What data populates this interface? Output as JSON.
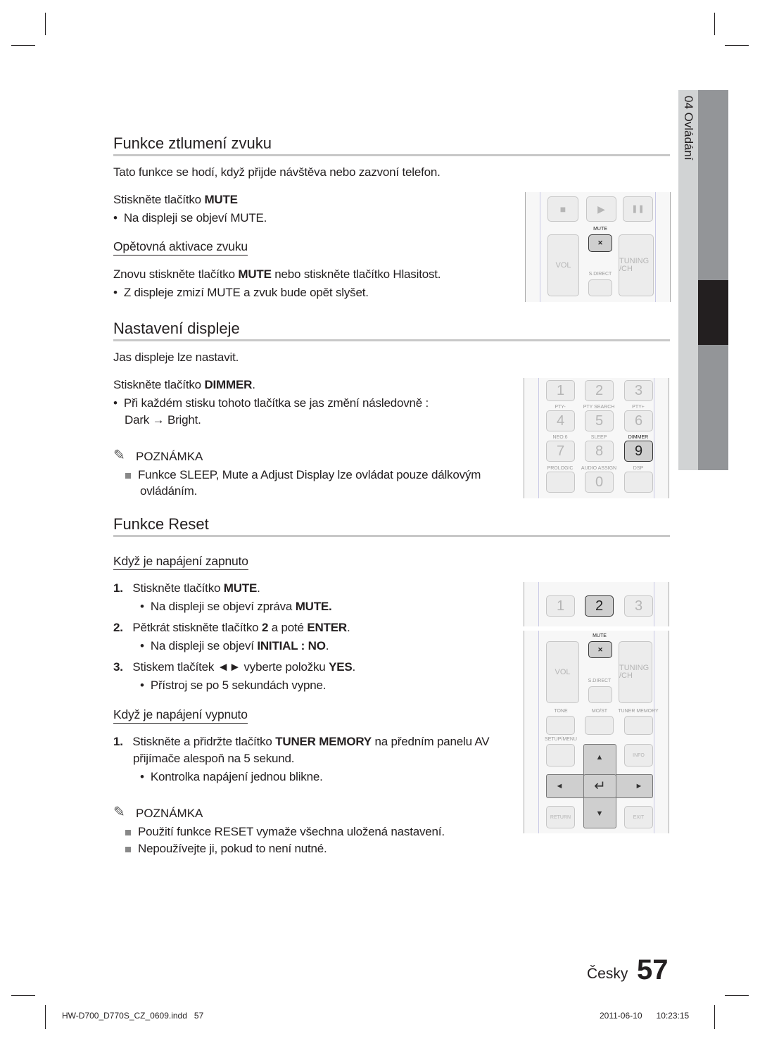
{
  "side_tab": {
    "label": "04  Ovládání"
  },
  "sections": {
    "mute": {
      "title": "Funkce ztlumení zvuku",
      "intro": "Tato funkce se hodí, když přijde návštěva nebo zazvoní telefon.",
      "press_prefix": "Stiskněte tlačítko ",
      "press_key": "MUTE",
      "bullet": "Na displeji se objeví MUTE.",
      "reactivate_title": "Opětovná aktivace zvuku",
      "reactivate_prefix": "Znovu stiskněte tlačítko ",
      "reactivate_key": "MUTE",
      "reactivate_suffix": " nebo stiskněte tlačítko Hlasitost.",
      "reactivate_bullet": "Z displeje zmizí MUTE a zvuk bude opět slyšet."
    },
    "display": {
      "title": "Nastavení displeje",
      "intro": "Jas displeje lze nastavit.",
      "press_prefix": "Stiskněte tlačítko ",
      "press_key": "DIMMER",
      "press_suffix": ".",
      "bullet_line1": "Při každém stisku tohoto tlačítka se jas změní následovně :",
      "bullet_line2": "Dark → Bright.",
      "note_title": "POZNÁMKA",
      "note_line1": "Funkce SLEEP, Mute a Adjust Display lze ovládat pouze dálkovým",
      "note_line2": "ovládáním."
    },
    "reset": {
      "title": "Funkce Reset",
      "on_title": "Když je napájení zapnuto",
      "step1_num": "1.",
      "step1_prefix": "Stiskněte tlačítko ",
      "step1_key": "MUTE",
      "step1_suffix": ".",
      "step1_bullet_prefix": "Na displeji se objeví zpráva ",
      "step1_bullet_key": "MUTE.",
      "step2_num": "2.",
      "step2_a": "Pětkrát stiskněte tlačítko ",
      "step2_key1": "2",
      "step2_b": " a poté ",
      "step2_key2": "ENTER",
      "step2_c": ".",
      "step2_bullet_prefix": "Na displeji se objeví ",
      "step2_bullet_key": "INITIAL : NO",
      "step2_bullet_suffix": ".",
      "step3_num": "3.",
      "step3_a": "Stiskem tlačítek ◄► vyberte položku ",
      "step3_key": "YES",
      "step3_b": ".",
      "step3_bullet": "Přístroj se po 5 sekundách vypne.",
      "off_title": "Když je napájení vypnuto",
      "off1_num": "1.",
      "off1_a": "Stiskněte a přidržte tlačítko ",
      "off1_key": "TUNER MEMORY",
      "off1_b": " na předním panelu AV",
      "off1_line2": "přijímače alespoň na 5 sekund.",
      "off1_bullet": "Kontrolka napájení jednou blikne.",
      "note_title": "POZNÁMKA",
      "note1": "Použití funkce RESET vymaže všechna uložená nastavení.",
      "note2": "Nepoužívejte ji, pokud to není nutné."
    }
  },
  "remotes": {
    "r1": {
      "stop": "■",
      "play": "▶",
      "pause": "❚❚",
      "mute_label": "MUTE",
      "mute_icon": "🔇",
      "vol": "VOL",
      "tuning": "TUNING /CH",
      "sdirect": "S.DIRECT"
    },
    "r2": {
      "keys": [
        "1",
        "2",
        "3",
        "4",
        "5",
        "6",
        "7",
        "8",
        "9",
        "0"
      ],
      "labels": [
        "PTY-",
        "PTY SEARCH",
        "PTY+",
        "NEO:6",
        "SLEEP",
        "DIMMER",
        "PROLOGIC",
        "AUDIO ASSIGN",
        "DSP"
      ]
    },
    "r3": {
      "keys": [
        "1",
        "2",
        "3"
      ],
      "mute_label": "MUTE",
      "vol": "VOL",
      "tuning": "TUNING /CH",
      "sdirect": "S.DIRECT",
      "tone": "TONE",
      "moist": "MO/ST",
      "tuner_memory": "TUNER MEMORY",
      "setup": "SETUP/MENU",
      "info": "INFO",
      "return": "RETURN",
      "exit": "EXIT",
      "up": "▲",
      "down": "▼",
      "left": "◄",
      "right": "►",
      "enter": "↵"
    }
  },
  "footer": {
    "language": "Česky",
    "page_number": "57",
    "file": "HW-D700_D770S_CZ_0609.indd",
    "file_page": "57",
    "date": "2011-06-10",
    "time": "10:23:15"
  }
}
